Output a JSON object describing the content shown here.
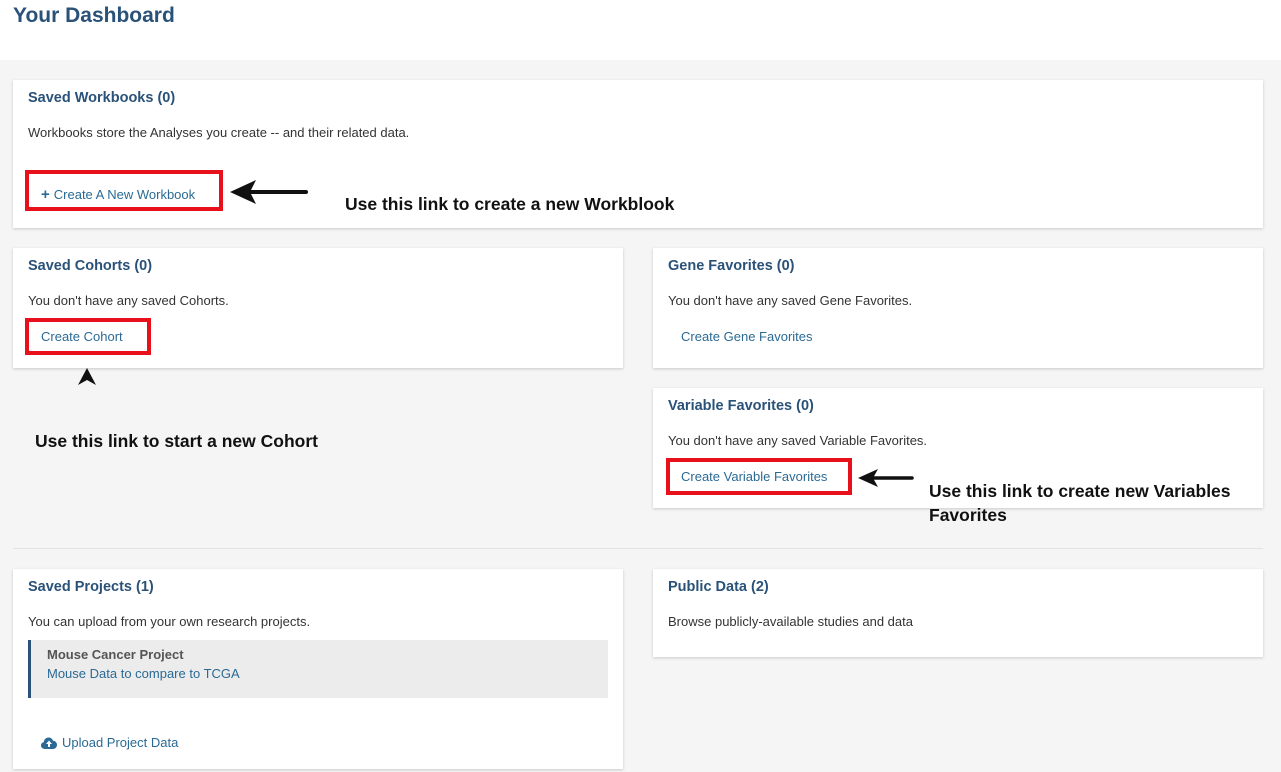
{
  "header": {
    "title": "Your Dashboard"
  },
  "workbooks": {
    "title": "Saved Workbooks (0)",
    "description": "Workbooks store the Analyses you create -- and their related data.",
    "create_link": "Create A New Workbook",
    "annotation": "Use this link to create a new Workblook"
  },
  "cohorts": {
    "title": "Saved Cohorts (0)",
    "description": "You don't have any saved Cohorts.",
    "create_link": "Create Cohort",
    "annotation": "Use this link to start a new Cohort"
  },
  "gene_favorites": {
    "title": "Gene Favorites (0)",
    "description": "You don't have any saved Gene Favorites.",
    "create_link": "Create Gene Favorites"
  },
  "variable_favorites": {
    "title": "Variable Favorites (0)",
    "description": "You don't have any saved Variable Favorites.",
    "create_link": "Create Variable Favorites",
    "annotation_line1": "Use this link to create new Variables",
    "annotation_line2": "Favorites"
  },
  "projects": {
    "title": "Saved Projects (1)",
    "description": "You can upload from your own research projects.",
    "items": [
      {
        "name": "Mouse Cancer Project",
        "description": "Mouse Data to compare to TCGA"
      }
    ],
    "upload_link": "Upload Project Data"
  },
  "public_data": {
    "title": "Public Data (2)",
    "description": "Browse publicly-available studies and data"
  },
  "colors": {
    "heading": "#2a5278",
    "link": "#2a6a94",
    "highlight": "#e8101a"
  },
  "icons": {
    "plus": "plus-icon",
    "upload": "cloud-upload-icon",
    "arrow": "arrow-left-icon",
    "pointer": "arrow-up-icon"
  }
}
